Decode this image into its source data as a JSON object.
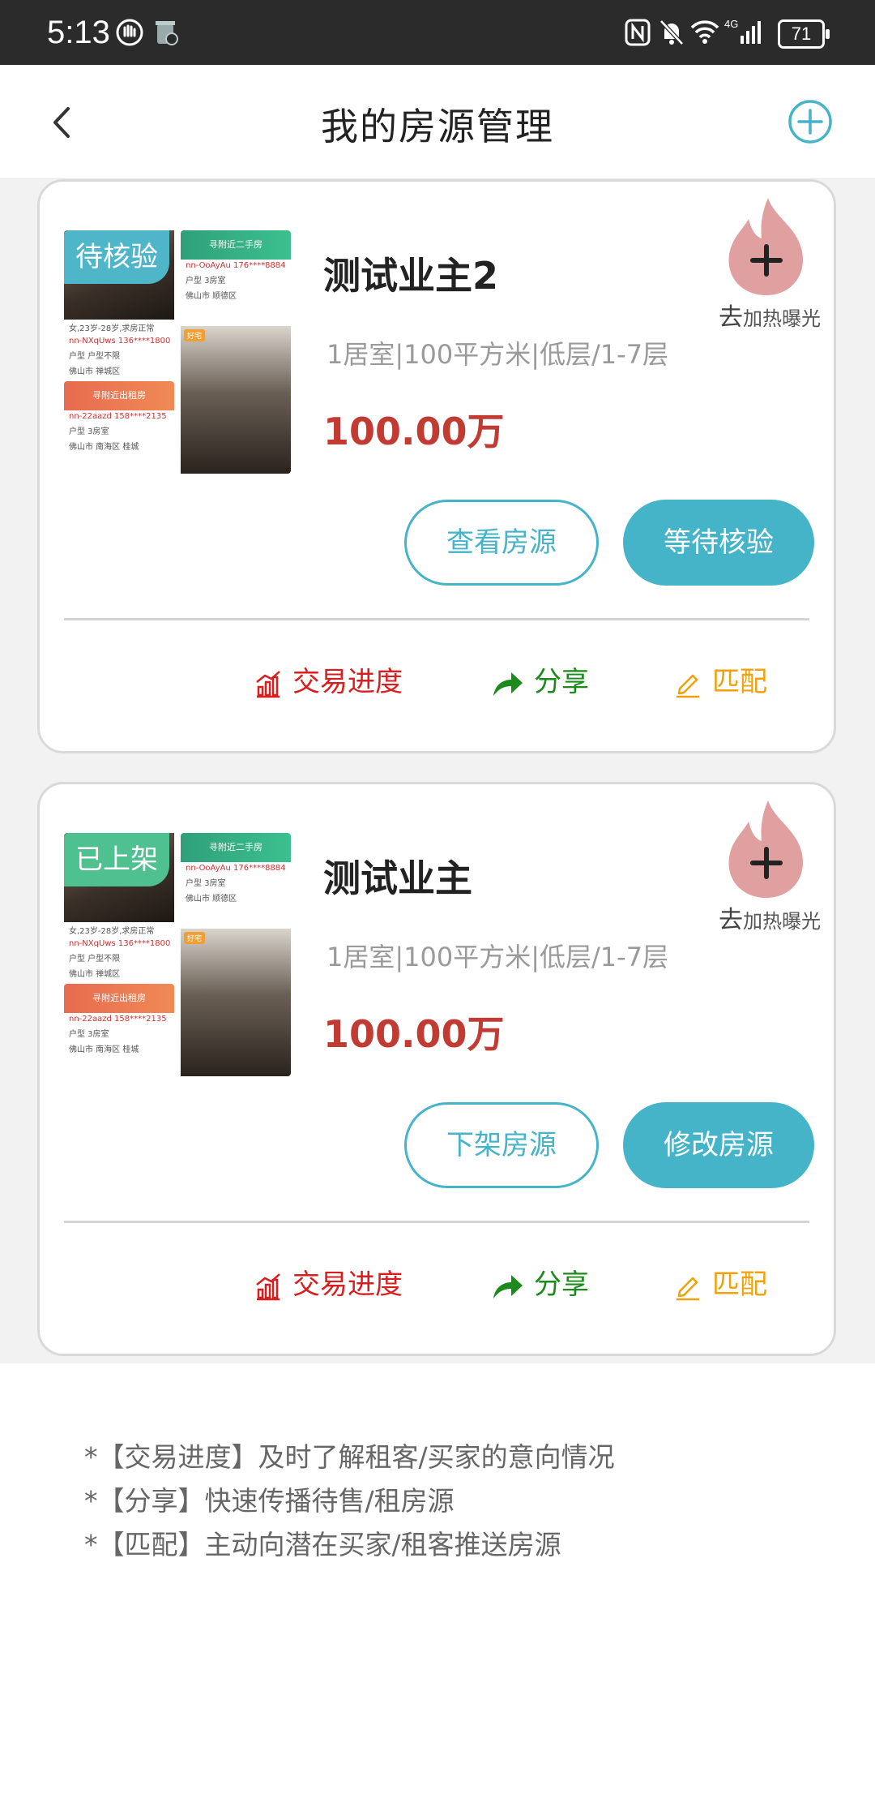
{
  "status_bar": {
    "time": "5:13",
    "battery": "71"
  },
  "header": {
    "title": "我的房源管理"
  },
  "listings": [
    {
      "status": "待核验",
      "status_color": "#4fb5c9",
      "title": "测试业主2",
      "meta": "1居室|100平方米|低层/1-7层",
      "price": "100.00万",
      "boost_prefix": "去",
      "boost_label": "加热曝光",
      "secondary_button": "查看房源",
      "primary_button": "等待核验",
      "actions": {
        "progress": "交易进度",
        "share": "分享",
        "match": "匹配"
      }
    },
    {
      "status": "已上架",
      "status_color": "#4fc08f",
      "title": "测试业主",
      "meta": "1居室|100平方米|低层/1-7层",
      "price": "100.00万",
      "boost_prefix": "去",
      "boost_label": "加热曝光",
      "secondary_button": "下架房源",
      "primary_button": "修改房源",
      "actions": {
        "progress": "交易进度",
        "share": "分享",
        "match": "匹配"
      }
    }
  ],
  "thumbnail": {
    "header_second_hand": "寻附近二手房",
    "header_rent": "寻附近出租房",
    "tag": "好宅",
    "lines_top": [
      "nn-OoAyAu 176****8884",
      "户型 3房室",
      "佛山市 顺德区"
    ],
    "lines_left": [
      "女,23岁-28岁,求房正常",
      "nn-NXqUws 136****1800",
      "户型 户型不限",
      "佛山市 禅城区"
    ],
    "lines_bottom": [
      "nn-22aazd 158****2135",
      "户型 3房室",
      "佛山市 南海区 桂城"
    ]
  },
  "notes": [
    "*【交易进度】及时了解租客/买家的意向情况",
    "*【分享】快速传播待售/租房源",
    "*【匹配】主动向潜在买家/租客推送房源"
  ],
  "colors": {
    "accent": "#46b4c8",
    "price": "#c23b33",
    "progress": "#d81e1e",
    "share": "#1c8a1c",
    "match": "#f0a10a"
  }
}
